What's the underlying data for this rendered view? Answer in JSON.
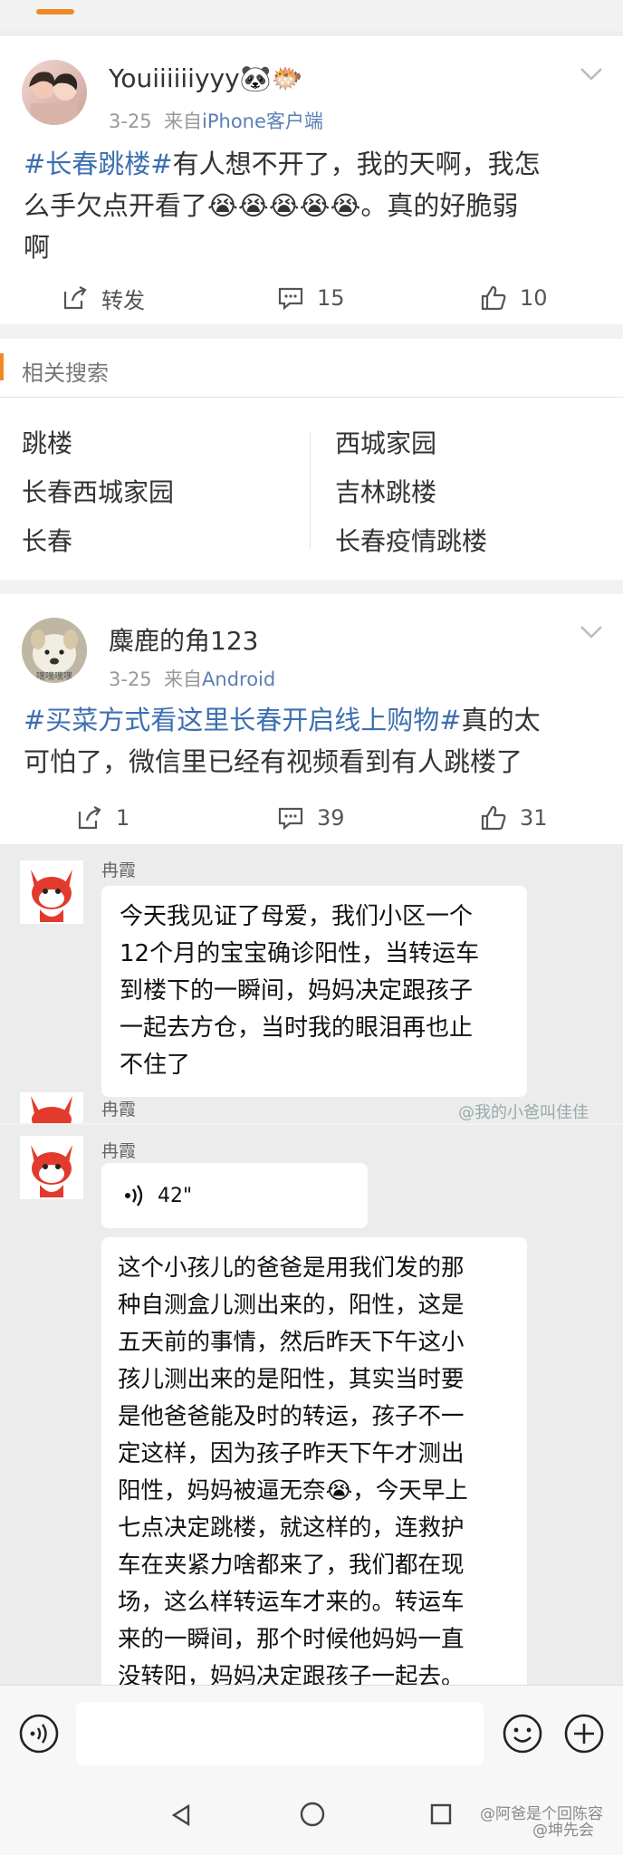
{
  "post1": {
    "username": "Youiiiiiiyyy🐼🐡",
    "date": "3-25",
    "from": "来自",
    "source": "iPhone客户端",
    "tag": "#长春跳楼#",
    "text_line1_rest": "有人想不开了，我的天啊，我怎",
    "text_line2": "么手欠点开看了😭😭😭😭😭。真的好脆弱",
    "text_line3": "啊",
    "repost_label": "转发",
    "comment_count": "15",
    "like_count": "10"
  },
  "related": {
    "title": "相关搜索",
    "items": [
      "跳楼",
      "西城家园",
      "长春西城家园",
      "吉林跳楼",
      "长春",
      "长春疫情跳楼"
    ]
  },
  "post2": {
    "username": "麋鹿的角123",
    "avatar_text": "嘿嘿嘿嘿",
    "date": "3-25",
    "from": "来自",
    "source": "Android",
    "tag": "#买菜方式看这里长春开启线上购物#",
    "text_line1_rest": "真的太",
    "text_line2": "可怕了，微信里已经有视频看到有人跳楼了",
    "repost_count": "1",
    "comment_count": "39",
    "like_count": "31"
  },
  "chat1": {
    "name": "冉霞",
    "lines": [
      "今天我见证了母爱，我们小区一个",
      "12个月的宝宝确诊阳性，当转运车",
      "到楼下的一瞬间，妈妈决定跟孩子",
      "一起去方仓，当时我的眼泪再也止",
      "不住了"
    ],
    "name2": "冉霞",
    "watermark": "@我的小爸叫佳佳"
  },
  "chat2": {
    "name": "冉霞",
    "voice_duration": "42\"",
    "lines": [
      "这个小孩儿的爸爸是用我们发的那",
      "种自测盒儿测出来的，阳性，这是",
      "五天前的事情，然后昨天下午这小",
      "孩儿测出来的是阳性，其实当时要",
      "是他爸爸能及时的转运，孩子不一",
      "定这样，因为孩子昨天下午才测出",
      "阳性，妈妈被逼无奈😭，今天早上",
      "七点决定跳楼，就这样的，连救护",
      "车在夹紧力啥都来了，我们都在现",
      "场，这么样转运车才来的。转运车",
      "来的一瞬间，那个时候他妈妈一直",
      "没转阳，妈妈决定跟孩子一起去。"
    ]
  },
  "footer": {
    "watermark": "@阿爸是个回陈容",
    "watermark2": "@坤先会"
  },
  "colors": {
    "accent": "#f08a24",
    "link": "#3d6fb0",
    "chat_bg": "#ececec"
  }
}
